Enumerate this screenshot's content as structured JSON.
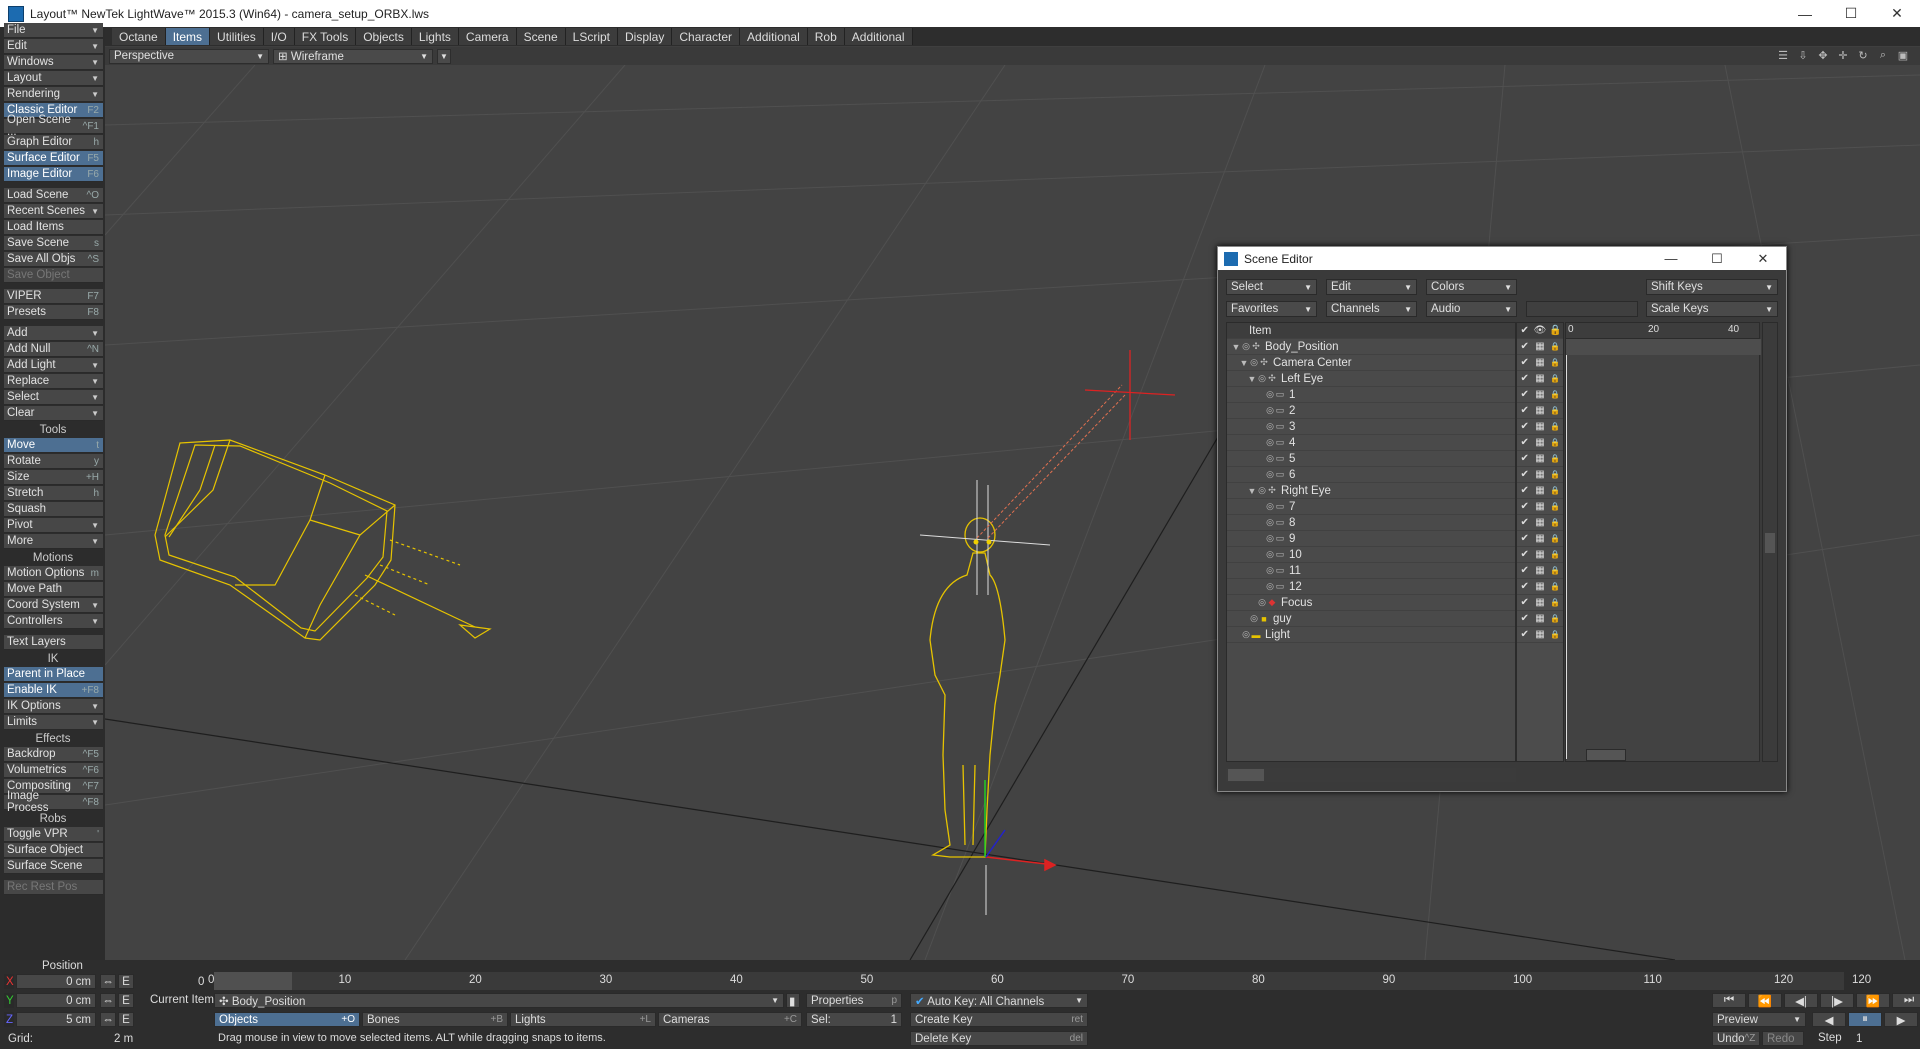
{
  "window": {
    "title": "Layout™ NewTek LightWave™ 2015.3 (Win64) - camera_setup_ORBX.lws",
    "min": "—",
    "max": "☐",
    "close": "✕"
  },
  "menu_file": "File",
  "tabs": [
    "Octane",
    "Items",
    "Utilities",
    "I/O",
    "FX Tools",
    "Objects",
    "Lights",
    "Camera",
    "Scene",
    "LScript",
    "Display",
    "Character",
    "Additional",
    "Rob",
    "Additional"
  ],
  "active_tab": "Items",
  "sidebar": [
    {
      "label": "Edit",
      "dd": true
    },
    {
      "label": "Windows",
      "dd": true
    },
    {
      "label": "Layout",
      "dd": true
    },
    {
      "label": "Rendering",
      "dd": true
    },
    {
      "label": "Classic Editor",
      "key": "F2",
      "hl": true
    },
    {
      "label": "Open Scene ...",
      "key": "^F1"
    },
    {
      "label": "Graph Editor",
      "key": "h"
    },
    {
      "label": "Surface Editor",
      "key": "F5",
      "hl": true
    },
    {
      "label": "Image Editor",
      "key": "F6",
      "hl": true
    },
    {
      "label": "Load Scene",
      "key": "^O",
      "gap": true
    },
    {
      "label": "Recent Scenes",
      "dd": true
    },
    {
      "label": "Load Items",
      "key": ""
    },
    {
      "label": "Save Scene",
      "key": "s"
    },
    {
      "label": "Save All Objs",
      "key": "^S"
    },
    {
      "label": "Save Object",
      "key": "",
      "dis": true
    },
    {
      "label": "VIPER",
      "key": "F7",
      "gap": true
    },
    {
      "label": "Presets",
      "key": "F8"
    },
    {
      "label": "Add",
      "dd": true,
      "gap": true
    },
    {
      "label": "Add Null",
      "key": "^N"
    },
    {
      "label": "Add Light",
      "dd": true
    },
    {
      "label": "Replace",
      "dd": true
    },
    {
      "label": "Select",
      "dd": true
    },
    {
      "label": "Clear",
      "dd": true
    },
    {
      "label": "Tools",
      "hdr": true
    },
    {
      "label": "Move",
      "key": "t",
      "hl": true
    },
    {
      "label": "Rotate",
      "key": "y"
    },
    {
      "label": "Size",
      "key": "+H"
    },
    {
      "label": "Stretch",
      "key": "h"
    },
    {
      "label": "Squash",
      "key": ""
    },
    {
      "label": "Pivot",
      "dd": true
    },
    {
      "label": "More",
      "dd": true
    },
    {
      "label": "Motions",
      "hdr": true
    },
    {
      "label": "Motion Options",
      "key": "m"
    },
    {
      "label": "Move Path",
      "key": ""
    },
    {
      "label": "Coord System",
      "dd": true
    },
    {
      "label": "Controllers",
      "dd": true
    },
    {
      "label": "Text Layers",
      "key": "",
      "gap": true
    },
    {
      "label": "IK",
      "hdr": true
    },
    {
      "label": "Parent in Place",
      "key": "",
      "hl": true
    },
    {
      "label": "Enable IK",
      "key": "+F8",
      "hl": true
    },
    {
      "label": "IK Options",
      "dd": true
    },
    {
      "label": "Limits",
      "dd": true
    },
    {
      "label": "Effects",
      "hdr": true
    },
    {
      "label": "Backdrop",
      "key": "^F5"
    },
    {
      "label": "Volumetrics",
      "key": "^F6"
    },
    {
      "label": "Compositing",
      "key": "^F7"
    },
    {
      "label": "Image Process",
      "key": "^F8"
    },
    {
      "label": "Robs",
      "hdr": true
    },
    {
      "label": "Toggle VPR",
      "key": "'"
    },
    {
      "label": "Surface Object",
      "key": ""
    },
    {
      "label": "Surface Scene",
      "key": ""
    },
    {
      "label": "Rec Rest Pos",
      "key": "",
      "dis": true,
      "gap": true
    }
  ],
  "viewport": {
    "view": "Perspective",
    "mode": "Wireframe",
    "mode_icon": "⊞"
  },
  "scene_editor": {
    "title": "Scene Editor",
    "row1": [
      "Select",
      "Edit",
      "Colors",
      "Shift Keys"
    ],
    "row2": [
      "Favorites",
      "Channels",
      "Audio",
      "Scale Keys"
    ],
    "header": "Item",
    "timeline_ticks": [
      "0",
      "20",
      "40"
    ],
    "items": [
      {
        "name": "Body_Position",
        "indent": 0,
        "exp": "▼"
      },
      {
        "name": "Camera Center",
        "indent": 1,
        "exp": "▼"
      },
      {
        "name": "Left Eye",
        "indent": 2,
        "exp": "▼"
      },
      {
        "name": "1",
        "indent": 3,
        "exp": ""
      },
      {
        "name": "2",
        "indent": 3,
        "exp": ""
      },
      {
        "name": "3",
        "indent": 3,
        "exp": ""
      },
      {
        "name": "4",
        "indent": 3,
        "exp": ""
      },
      {
        "name": "5",
        "indent": 3,
        "exp": ""
      },
      {
        "name": "6",
        "indent": 3,
        "exp": ""
      },
      {
        "name": "Right Eye",
        "indent": 2,
        "exp": "▼"
      },
      {
        "name": "7",
        "indent": 3,
        "exp": ""
      },
      {
        "name": "8",
        "indent": 3,
        "exp": ""
      },
      {
        "name": "9",
        "indent": 3,
        "exp": ""
      },
      {
        "name": "10",
        "indent": 3,
        "exp": ""
      },
      {
        "name": "11",
        "indent": 3,
        "exp": ""
      },
      {
        "name": "12",
        "indent": 3,
        "exp": ""
      },
      {
        "name": "Focus",
        "indent": 2,
        "exp": ""
      },
      {
        "name": "guy",
        "indent": 1,
        "exp": ""
      },
      {
        "name": "Light",
        "indent": 0,
        "exp": ""
      }
    ]
  },
  "bottom": {
    "position_label": "Position",
    "x_label": "X",
    "x_val": "0 cm",
    "y_label": "Y",
    "y_val": "0 cm",
    "z_label": "Z",
    "z_val": "5 cm",
    "grid_label": "Grid:",
    "grid_val": "2 m",
    "frame_start": "0",
    "ruler": [
      "0",
      "10",
      "20",
      "30",
      "40",
      "50",
      "60",
      "70",
      "80",
      "90",
      "100",
      "110",
      "120"
    ],
    "frame_end": "120",
    "current_item_label": "Current Item",
    "current_item": "Body_Position",
    "properties": "Properties",
    "properties_key": "p",
    "auto_key": "Auto Key: All Channels",
    "objects": "Objects",
    "objects_key": "+O",
    "bones": "Bones",
    "bones_key": "+B",
    "lights": "Lights",
    "lights_key": "+L",
    "cameras": "Cameras",
    "cameras_key": "+C",
    "sel_label": "Sel:",
    "sel_val": "1",
    "create_key": "Create Key",
    "create_key_k": "ret",
    "delete_key": "Delete Key",
    "delete_key_k": "del",
    "status": "Drag mouse in view to move selected items. ALT while dragging snaps to items.",
    "preview": "Preview",
    "undo": "Undo",
    "undo_k": "^Z",
    "redo": "Redo",
    "step_label": "Step",
    "step_val": "1",
    "e_label": "E"
  }
}
